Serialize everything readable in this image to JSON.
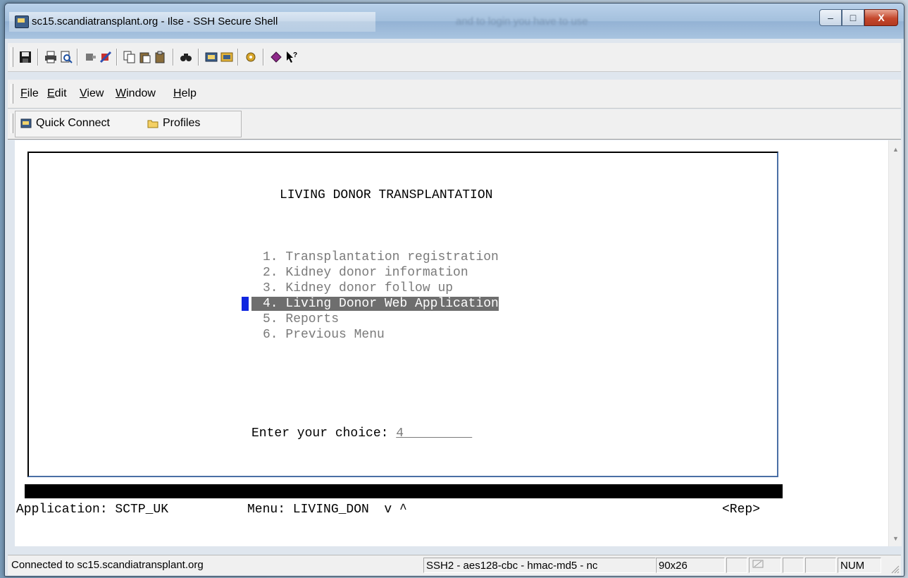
{
  "window": {
    "title": "sc15.scandiatransplant.org - Ilse - SSH Secure Shell",
    "background_text": "and to login you have to use",
    "minimize_glyph": "–",
    "maximize_glyph": "□",
    "close_glyph": "X"
  },
  "toolbar": {
    "icons": [
      "save-icon",
      "print-icon",
      "print-preview-icon",
      "disconnect-icon",
      "connect-icon",
      "copy-icon",
      "paste-icon",
      "paste-special-icon",
      "find-icon",
      "new-terminal-icon",
      "new-file-transfer-icon",
      "settings-icon",
      "help-book-icon",
      "context-help-icon"
    ]
  },
  "menu": {
    "items": [
      {
        "underline": "F",
        "rest": "ile"
      },
      {
        "underline": "E",
        "rest": "dit"
      },
      {
        "underline": "V",
        "rest": "iew"
      },
      {
        "underline": "W",
        "rest": "indow"
      },
      {
        "underline": "H",
        "rest": "elp"
      }
    ]
  },
  "quickbar": {
    "quick_connect": "Quick Connect",
    "profiles": "Profiles"
  },
  "terminal": {
    "heading": "LIVING DONOR TRANSPLANTATION",
    "options": [
      "1. Transplantation registration",
      "2. Kidney donor information",
      "3. Kidney donor follow up",
      "4. Living Donor Web Application",
      "5. Reports",
      "6. Previous Menu"
    ],
    "selected_index": 3,
    "prompt": "Enter your choice: ",
    "choice_value": "4",
    "choice_padding": "         ",
    "status_application": "Application: SCTP_UK",
    "status_menu": "Menu: LIVING_DON  v ^",
    "status_rep": "<Rep>"
  },
  "statusbar": {
    "connected": "Connected to sc15.scandiatransplant.org",
    "cipher": "SSH2 - aes128-cbc - hmac-md5 - nc",
    "size": "90x26",
    "num": "NUM"
  },
  "colors": {
    "highlight": "#6e6e6e",
    "cursor": "#1026e0",
    "menu_text": "#7a7a7a"
  }
}
